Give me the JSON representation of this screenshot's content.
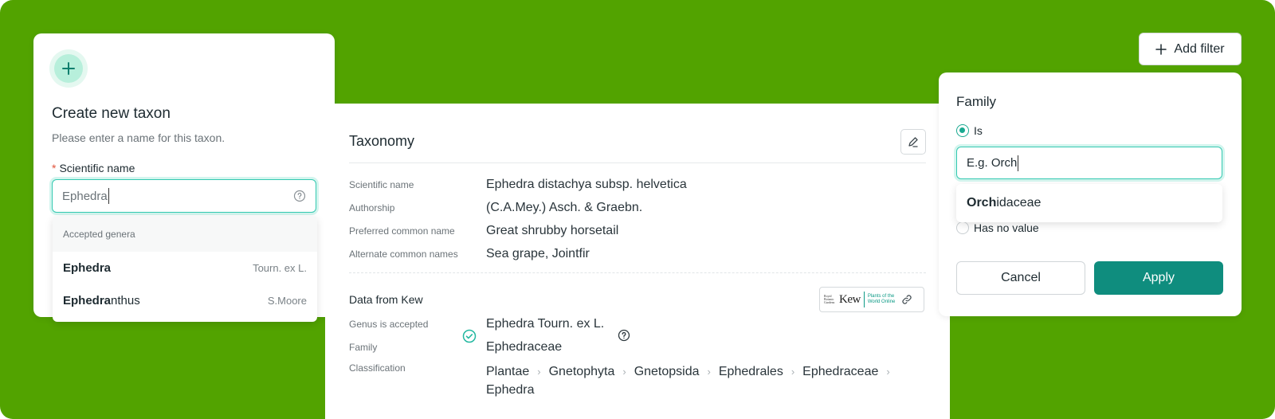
{
  "colors": {
    "background": "#52a300",
    "accent_teal": "#0f8d7e",
    "focus_ring": "#34c9b1",
    "required_asterisk": "#e0533b"
  },
  "create_taxon": {
    "icon": "plus-icon",
    "title": "Create new taxon",
    "subtitle": "Please enter a name for this taxon.",
    "required_mark": "*",
    "field_label": "Scientific name",
    "input_value": "Ephedra",
    "help_icon": "question-circle-icon",
    "dropdown": {
      "header": "Accepted genera",
      "items": [
        {
          "match": "Ephedra",
          "rest": "",
          "author": "Tourn. ex L."
        },
        {
          "match": "Ephedra",
          "rest": "nthus",
          "author": "S.Moore"
        }
      ]
    }
  },
  "taxonomy": {
    "title": "Taxonomy",
    "edit_icon": "pencil-icon",
    "rows": [
      {
        "label": "Scientific name",
        "value": "Ephedra distachya subsp. helvetica"
      },
      {
        "label": "Authorship",
        "value": "(C.A.Mey.) Asch. & Graebn."
      },
      {
        "label": "Preferred common name",
        "value": "Great shrubby horsetail"
      },
      {
        "label": "Alternate common names",
        "value": "Sea grape, Jointfir"
      }
    ],
    "kew": {
      "title": "Data from Kew",
      "badge_rbg": "Royal Botanic Gardens",
      "badge_word": "Kew",
      "badge_powo": "Plants of the World Online",
      "link_icon": "link-icon",
      "genus_label": "Genus is accepted",
      "genus_value": "Ephedra Tourn. ex L.",
      "family_label": "Family",
      "family_value": "Ephedraceae",
      "classification_label": "Classification",
      "classification": [
        "Plantae",
        "Gnetophyta",
        "Gnetopsida",
        "Ephedrales",
        "Ephedraceae",
        "Ephedra"
      ]
    }
  },
  "filter": {
    "add_label": "Add filter",
    "title": "Family",
    "option_is": "Is",
    "input_value": "E.g. Orch",
    "suggestion_match": "Orch",
    "suggestion_rest": "idaceae",
    "option_no_value": "Has no value",
    "cancel_label": "Cancel",
    "apply_label": "Apply"
  }
}
